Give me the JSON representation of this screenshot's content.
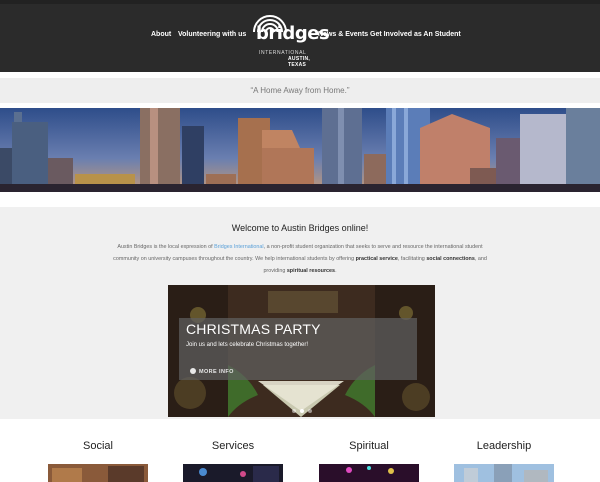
{
  "nav": {
    "left": [
      "About",
      "Volunteering with us"
    ],
    "right": [
      "News & Events",
      "Get Involved as An Student"
    ]
  },
  "logo": {
    "word": "bridges",
    "line1": "INTERNATIONAL",
    "line2": "AUSTIN, TEXAS"
  },
  "tagline": "“A Home Away from Home.”",
  "welcome": {
    "title": "Welcome to Austin Bridges online!",
    "t1": "Austin Bridges is the local expression of ",
    "link": "Bridges International",
    "t2": ", a non-profit student organization that seeks to serve and resource the international student community on university campuses throughout the country. We help international students by offering ",
    "b1": "practical service",
    "t3": ", facilitating ",
    "b2": "social connections",
    "t4": ", and providing ",
    "b3": "spiritual resources",
    "t5": "."
  },
  "slider": {
    "title": "CHRISTMAS PARTY",
    "description": "Join us and lets celebrate Christmas together!",
    "more_label": "MORE INFO",
    "slide_count": 3,
    "active_slide": 2
  },
  "categories": [
    {
      "label": "Social"
    },
    {
      "label": "Services"
    },
    {
      "label": "Spiritual"
    },
    {
      "label": "Leadership"
    }
  ],
  "colors": {
    "header_bg": "#2b2b2b",
    "link": "#5aa0d8",
    "section_bg": "#f0f0f0"
  }
}
